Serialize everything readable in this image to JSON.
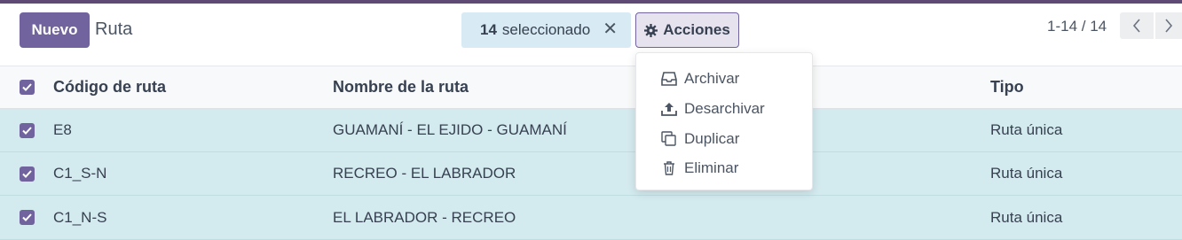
{
  "toolbar": {
    "new_label": "Nuevo",
    "breadcrumb": "Ruta",
    "selected_count": "14",
    "selected_label": "seleccionado",
    "actions_label": "Acciones"
  },
  "pager": {
    "value": "1-14 / 14"
  },
  "table": {
    "headers": {
      "code": "Código de ruta",
      "name": "Nombre de la ruta",
      "type": "Tipo"
    },
    "rows": [
      {
        "code": "E8",
        "name": "GUAMANÍ - EL EJIDO - GUAMANÍ",
        "type": "Ruta única",
        "selected": true
      },
      {
        "code": "C1_S-N",
        "name": "RECREO - EL LABRADOR",
        "type": "Ruta única",
        "selected": true
      },
      {
        "code": "C1_N-S",
        "name": "EL LABRADOR - RECREO",
        "type": "Ruta única",
        "selected": true
      }
    ]
  },
  "actions_menu": {
    "items": [
      {
        "label": "Archivar",
        "icon": "inbox-icon"
      },
      {
        "label": "Desarchivar",
        "icon": "upload-icon"
      },
      {
        "label": "Duplicar",
        "icon": "copy-icon"
      },
      {
        "label": "Eliminar",
        "icon": "trash-icon"
      }
    ]
  },
  "colors": {
    "primary": "#71639e",
    "selected_row": "#d3eaee",
    "selection_pill": "#d8ebf4"
  }
}
